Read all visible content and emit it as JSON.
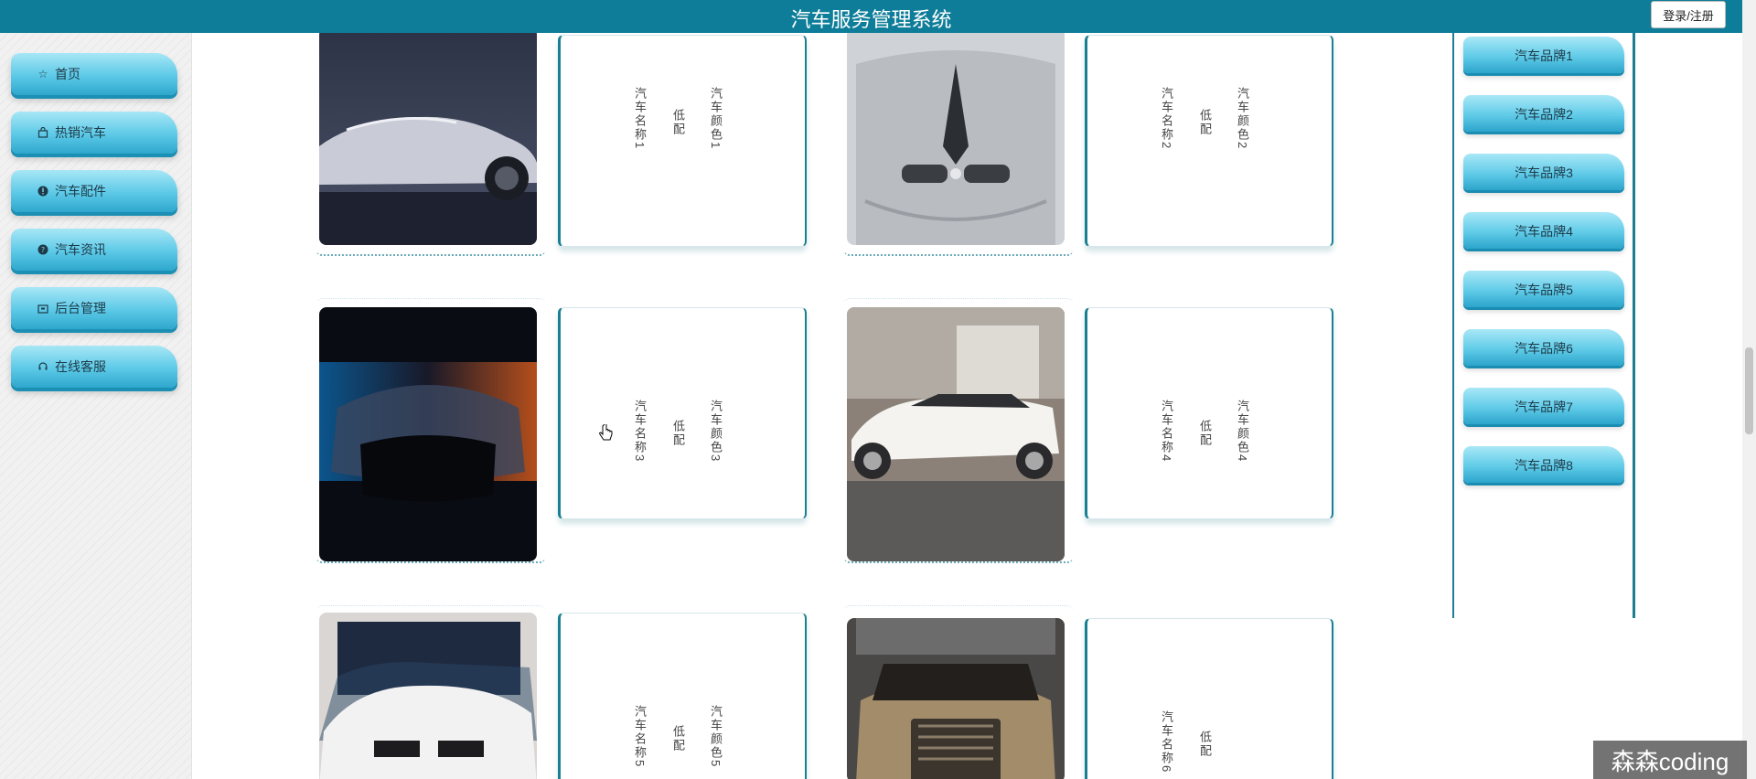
{
  "header": {
    "title": "汽车服务管理系统",
    "login_label": "登录/注册"
  },
  "sidebar": {
    "items": [
      {
        "label": "首页",
        "icon": "star-icon"
      },
      {
        "label": "热销汽车",
        "icon": "bag-icon"
      },
      {
        "label": "汽车配件",
        "icon": "info-icon"
      },
      {
        "label": "汽车资讯",
        "icon": "question-icon"
      },
      {
        "label": "后台管理",
        "icon": "folder-icon"
      },
      {
        "label": "在线客服",
        "icon": "headset-icon"
      }
    ]
  },
  "cars": [
    {
      "name": "汽车名称1",
      "config": "低配",
      "color": "汽车颜色1"
    },
    {
      "name": "汽车名称2",
      "config": "低配",
      "color": "汽车颜色2"
    },
    {
      "name": "汽车名称3",
      "config": "低配",
      "color": "汽车颜色3"
    },
    {
      "name": "汽车名称4",
      "config": "低配",
      "color": "汽车颜色4"
    },
    {
      "name": "汽车名称5",
      "config": "低配",
      "color": "汽车颜色5"
    },
    {
      "name": "汽车名称6",
      "config": "低配",
      "color": ""
    }
  ],
  "brands": [
    {
      "label": "汽车品牌1"
    },
    {
      "label": "汽车品牌2"
    },
    {
      "label": "汽车品牌3"
    },
    {
      "label": "汽车品牌4"
    },
    {
      "label": "汽车品牌5"
    },
    {
      "label": "汽车品牌6"
    },
    {
      "label": "汽车品牌7"
    },
    {
      "label": "汽车品牌8"
    }
  ],
  "watermark": "森森coding",
  "colors": {
    "header": "#0e7d99",
    "accent": "#1a7f92",
    "nav_gradient_top": "#a7e7f6",
    "nav_gradient_bottom": "#2ea7cd"
  }
}
